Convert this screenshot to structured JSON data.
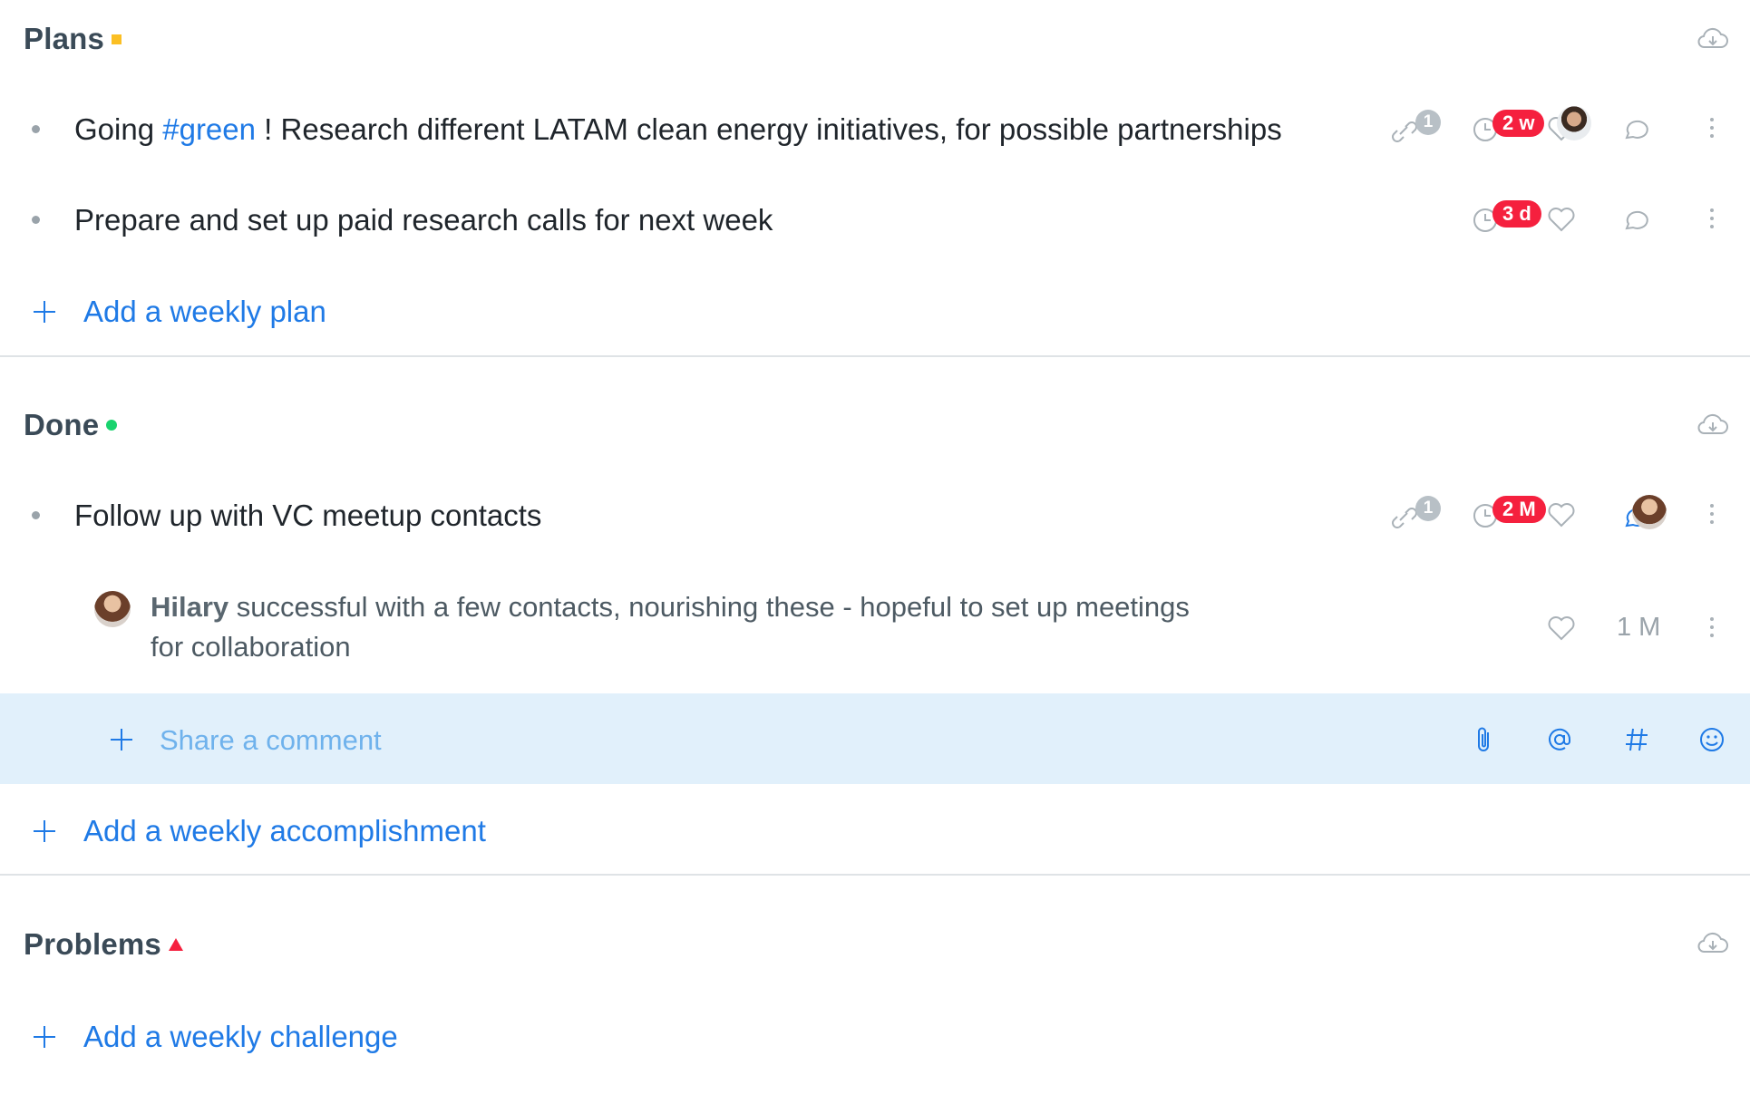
{
  "sections": [
    {
      "title": "Plans",
      "marker": "yellow-square",
      "items": [
        {
          "text_before": "Going ",
          "tag": "#green",
          "text_after": " ! Research different LATAM clean energy initiatives, for possible partnerships",
          "links_count": "1",
          "due": "2 w"
        },
        {
          "text": "Prepare and set up paid research calls for next week",
          "due": "3 d"
        }
      ],
      "add_label": "Add a weekly plan"
    },
    {
      "title": "Done",
      "marker": "green-dot",
      "items": [
        {
          "text": "Follow up with VC meetup contacts",
          "links_count": "1",
          "due": "2 M",
          "comments": [
            {
              "author": "Hilary",
              "text": " successful with a few contacts, nourishing these - hopeful to set up meetings for collaboration",
              "age": "1 M"
            }
          ]
        }
      ],
      "comment_placeholder": "Share a comment",
      "add_label": "Add a weekly accomplishment"
    },
    {
      "title": "Problems",
      "marker": "red-triangle",
      "add_label": "Add a weekly challenge"
    }
  ],
  "colors": {
    "accent": "#1f7ae6",
    "due_badge": "#f5203e",
    "plans_marker": "#fbbf24",
    "done_marker": "#19d36e",
    "problems_marker": "#f5203e",
    "comment_band": "#e1f0fb"
  },
  "icons": [
    "cloud-download-icon",
    "link-icon",
    "clock-icon",
    "heart-icon",
    "comment-icon",
    "more-vertical-icon",
    "plus-icon",
    "paperclip-icon",
    "at-icon",
    "hash-icon",
    "smiley-icon"
  ]
}
